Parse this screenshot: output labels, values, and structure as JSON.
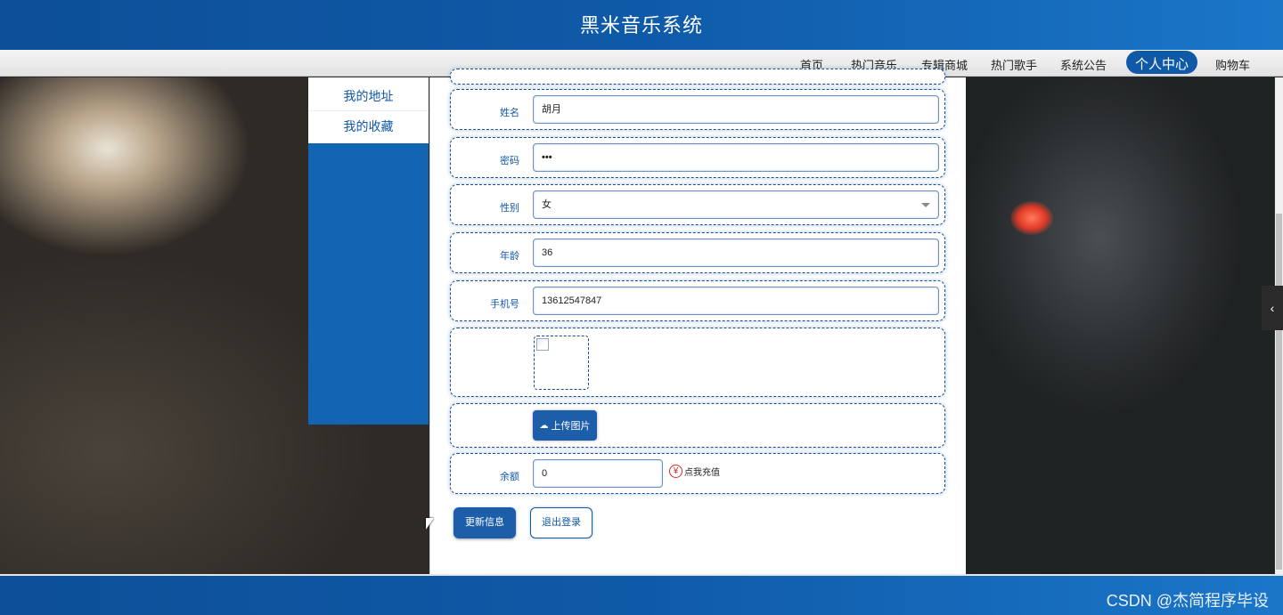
{
  "header": {
    "title": "黑米音乐系统"
  },
  "nav": {
    "items": [
      {
        "label": "首页"
      },
      {
        "label": "热门音乐"
      },
      {
        "label": "专辑商城"
      },
      {
        "label": "热门歌手"
      },
      {
        "label": "系统公告"
      },
      {
        "label": "个人中心",
        "active": true
      },
      {
        "label": "购物车"
      }
    ]
  },
  "sidebar": {
    "items": [
      {
        "label": "我的地址"
      },
      {
        "label": "我的收藏"
      }
    ]
  },
  "form": {
    "name": {
      "label": "姓名",
      "value": "胡月"
    },
    "password": {
      "label": "密码",
      "value": "•••"
    },
    "gender": {
      "label": "性别",
      "value": "女"
    },
    "age": {
      "label": "年龄",
      "value": "36"
    },
    "phone": {
      "label": "手机号",
      "value": "13612547847"
    },
    "upload_label": "上传图片",
    "balance": {
      "label": "余额",
      "value": "0",
      "recharge_label": "点我充值",
      "currency_symbol": "¥"
    }
  },
  "actions": {
    "update_label": "更新信息",
    "logout_label": "退出登录"
  },
  "footer": {
    "watermark": "CSDN @杰简程序毕设"
  },
  "colors": {
    "primary": "#1158a8",
    "header": "#0f5aa8",
    "accent_red": "#d52a2a"
  }
}
